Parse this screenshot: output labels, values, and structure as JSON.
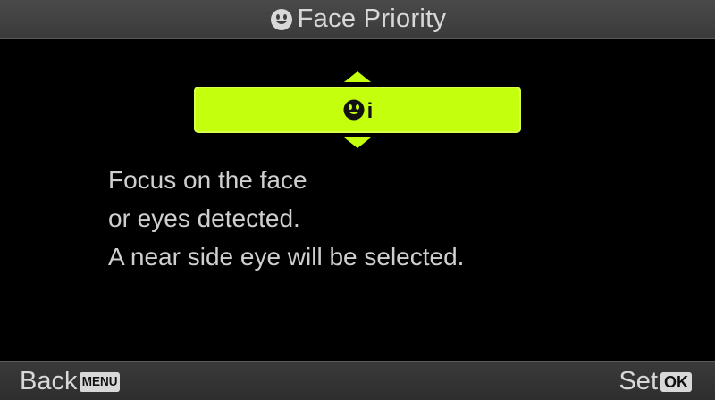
{
  "header": {
    "icon": "face-priority-icon",
    "title": "Face Priority"
  },
  "selector": {
    "icon": "face-icon",
    "suffix": "i",
    "highlight_color": "#c4ff0e"
  },
  "description": {
    "lines": [
      "Focus on the face",
      "or eyes detected.",
      "A near side eye will be selected."
    ]
  },
  "footer": {
    "back_label": "Back",
    "back_key": "MENU",
    "set_label": "Set",
    "set_key": "OK"
  }
}
